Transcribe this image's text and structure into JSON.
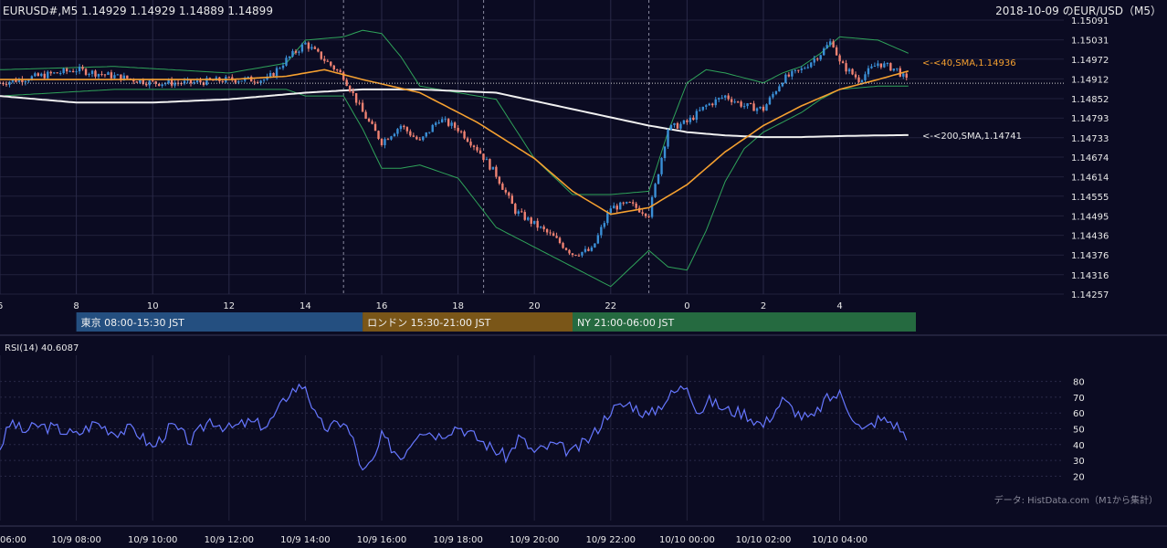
{
  "header": {
    "symbol_quote": "EURUSD#,M5 1.14929 1.14929 1.14889 1.14899",
    "chart_title": "2018-10-09 のEUR/USD（M5）"
  },
  "colors": {
    "background": "#0b0b22",
    "candle_up": "#3a8fd6",
    "candle_down": "#f08272",
    "sma40": "#f5a030",
    "sma200": "#f0f0f0",
    "bollinger": "#2fa35a",
    "rsi_line": "#6677ff",
    "tokyo": "#244f80",
    "london": "#7a5618",
    "newyork": "#256a40",
    "axis_text": "#e8e8e8"
  },
  "icons": {
    "arrow_marker": "<-"
  },
  "chart_data": [
    {
      "type": "candlestick",
      "name": "price",
      "x_tick_labels": [
        "6",
        "8",
        "10",
        "12",
        "14",
        "16",
        "18",
        "20",
        "22",
        "0",
        "2",
        "4"
      ],
      "y_tick_labels": [
        "1.15091",
        "1.15031",
        "1.14972",
        "1.14912",
        "1.14852",
        "1.14793",
        "1.14733",
        "1.14674",
        "1.14614",
        "1.14555",
        "1.14495",
        "1.14436",
        "1.14376",
        "1.14316",
        "1.14257"
      ],
      "ylim": [
        1.14257,
        1.15091
      ],
      "current_price": 1.14899,
      "session_markers_hours": [
        15,
        18.67,
        23
      ],
      "sma40_label": "<-<40,SMA,1.14936",
      "sma200_label": "<-<200,SMA,1.14741",
      "price_path": {
        "hours": [
          6,
          7,
          8,
          9,
          10,
          11,
          12,
          13,
          13.5,
          14,
          14.5,
          15,
          15.5,
          16,
          16.5,
          17,
          17.5,
          18,
          18.5,
          19,
          19.5,
          20,
          20.5,
          21,
          21.5,
          22,
          22.5,
          23,
          23.5,
          0,
          0.5,
          1,
          1.5,
          2,
          2.5,
          3,
          3.5,
          3.8,
          4,
          4.5,
          5,
          5.5,
          5.8
        ],
        "values": [
          1.149,
          1.1492,
          1.1494,
          1.1492,
          1.149,
          1.149,
          1.1491,
          1.1491,
          1.1497,
          1.1502,
          1.1497,
          1.1492,
          1.1481,
          1.1472,
          1.1477,
          1.1472,
          1.1479,
          1.1476,
          1.147,
          1.1462,
          1.1451,
          1.1447,
          1.1443,
          1.1438,
          1.1439,
          1.1452,
          1.1453,
          1.145,
          1.1476,
          1.1478,
          1.1483,
          1.1486,
          1.1483,
          1.1482,
          1.1491,
          1.1494,
          1.1499,
          1.1503,
          1.1496,
          1.1491,
          1.1496,
          1.1494,
          1.149
        ]
      },
      "sma40_path": {
        "hours": [
          6,
          9,
          12,
          13.5,
          14.5,
          15.5,
          17,
          18.5,
          20,
          21,
          22,
          23,
          0,
          1,
          2,
          3,
          4,
          5,
          5.8
        ],
        "values": [
          1.1491,
          1.1491,
          1.1491,
          1.1492,
          1.1494,
          1.1491,
          1.1487,
          1.1478,
          1.1467,
          1.1457,
          1.145,
          1.1452,
          1.1459,
          1.1469,
          1.1477,
          1.1483,
          1.1488,
          1.1491,
          1.14936
        ]
      },
      "sma200_path": {
        "hours": [
          6,
          8,
          10,
          12,
          14,
          15.5,
          17,
          19,
          21,
          23,
          0,
          1,
          2,
          3,
          4,
          5,
          5.8
        ],
        "values": [
          1.1486,
          1.1484,
          1.1484,
          1.1485,
          1.1487,
          1.1488,
          1.1488,
          1.1487,
          1.1482,
          1.1477,
          1.1475,
          1.1474,
          1.14735,
          1.14735,
          1.14738,
          1.1474,
          1.14741
        ]
      },
      "bollinger_upper_path": {
        "hours": [
          6,
          9,
          12,
          13.5,
          14,
          15,
          15.5,
          16,
          16.5,
          17,
          18,
          19,
          20,
          21,
          22,
          23,
          23.5,
          0,
          0.5,
          1,
          2,
          2.5,
          3,
          3.5,
          4,
          5,
          5.8
        ],
        "values": [
          1.1494,
          1.1495,
          1.1493,
          1.1496,
          1.1503,
          1.1504,
          1.1506,
          1.1505,
          1.1498,
          1.1489,
          1.1487,
          1.1485,
          1.1467,
          1.1456,
          1.1456,
          1.1457,
          1.1475,
          1.149,
          1.1494,
          1.1493,
          1.149,
          1.1493,
          1.1495,
          1.1499,
          1.1504,
          1.1503,
          1.1499
        ]
      },
      "bollinger_lower_path": {
        "hours": [
          6,
          9,
          12,
          13.5,
          14,
          15,
          15.5,
          16,
          16.5,
          17,
          18,
          19,
          20,
          21,
          22,
          23,
          23.5,
          0,
          0.5,
          1,
          1.5,
          2,
          3,
          3.5,
          4,
          5,
          5.8
        ],
        "values": [
          1.1486,
          1.1488,
          1.1488,
          1.1488,
          1.1486,
          1.1486,
          1.1476,
          1.1464,
          1.1464,
          1.1465,
          1.1461,
          1.1446,
          1.144,
          1.1434,
          1.1428,
          1.1439,
          1.1434,
          1.1433,
          1.1445,
          1.146,
          1.147,
          1.1475,
          1.1481,
          1.1485,
          1.1488,
          1.1489,
          1.1489
        ]
      }
    },
    {
      "type": "bar",
      "name": "sessions",
      "categories": [
        "東京 08:00-15:30 JST",
        "ロンドン 15:30-21:00 JST",
        "NY 21:00-06:00 JST"
      ],
      "start_hours": [
        8,
        15.5,
        21
      ],
      "end_hours": [
        15.5,
        21,
        30
      ]
    },
    {
      "type": "line",
      "name": "RSI",
      "title": "RSI(14) 40.6087",
      "y_tick_labels": [
        "80",
        "70",
        "60",
        "50",
        "40",
        "30",
        "20"
      ],
      "ylim": [
        15,
        85
      ],
      "current_value": 40.6087,
      "source_note": "データ: HistData.com（M1から集計）",
      "x_tick_labels": [
        "06:00",
        "10/9 08:00",
        "10/9 10:00",
        "10/9 12:00",
        "10/9 14:00",
        "10/9 16:00",
        "10/9 18:00",
        "10/9 20:00",
        "10/9 22:00",
        "10/10 00:00",
        "10/10 02:00",
        "10/10 04:00"
      ],
      "rsi_path": {
        "hours": [
          6,
          6.3,
          6.6,
          7,
          7.5,
          8,
          8.5,
          9,
          9.5,
          10,
          10.5,
          11,
          11.5,
          12,
          12.5,
          13,
          13.3,
          13.6,
          14,
          14.3,
          14.6,
          15,
          15.3,
          15.5,
          15.8,
          16,
          16.5,
          17,
          17.5,
          18,
          18.5,
          19,
          19.3,
          19.6,
          20,
          20.5,
          21,
          21.5,
          22,
          22.5,
          23,
          23.3,
          23.6,
          0,
          0.3,
          0.6,
          1,
          1.5,
          2,
          2.5,
          3,
          3.3,
          3.6,
          4,
          4.3,
          4.6,
          5,
          5.3,
          5.6,
          5.8
        ],
        "values": [
          38,
          55,
          48,
          52,
          50,
          46,
          54,
          48,
          50,
          38,
          52,
          42,
          56,
          50,
          54,
          52,
          62,
          74,
          78,
          55,
          50,
          55,
          40,
          22,
          30,
          45,
          32,
          50,
          46,
          52,
          44,
          36,
          32,
          45,
          35,
          40,
          35,
          45,
          62,
          66,
          58,
          65,
          72,
          78,
          60,
          68,
          62,
          60,
          52,
          68,
          58,
          56,
          68,
          72,
          60,
          48,
          56,
          55,
          50,
          40.6087
        ]
      }
    }
  ]
}
